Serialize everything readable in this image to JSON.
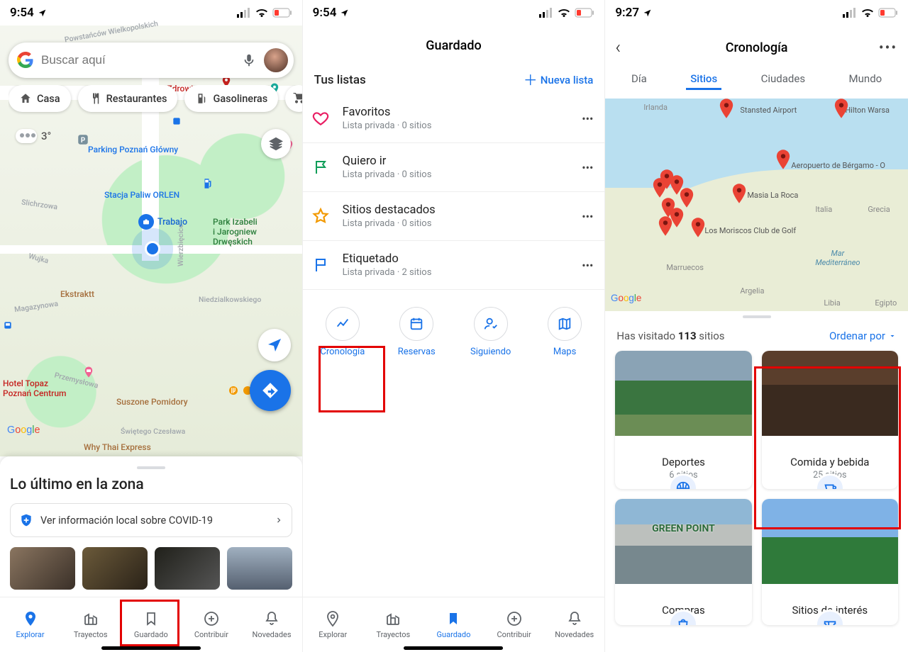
{
  "status": {
    "time1": "9:54",
    "time2": "9:54",
    "time3": "9:27"
  },
  "s1": {
    "search_placeholder": "Buscar aquí",
    "chips": {
      "home": "Casa",
      "restaurants": "Restaurantes",
      "gas": "Gasolineras"
    },
    "weather": "3°",
    "work_label": "Trabajo",
    "map_labels": {
      "pzu": "PZU Zdrowie",
      "parking": "Parking Poznań Główny",
      "orlen": "Stacja Paliw ORLEN",
      "park": "Park Izabeli\ni Jarogniew\nDrwęskich",
      "ekstraktt": "Ekstraktt",
      "topaz": "Hotel Topaz\nPoznań Centrum",
      "suszone": "Suszone Pomidory",
      "thai": "Why Thai Express",
      "slichrzowa": "Slichrzowa",
      "wierzbięcice": "Wierzbięcice",
      "niedz": "Niedzialkowskiego",
      "magazynowa": "Magazynowa",
      "przemyslowa": "Przemysłowa",
      "wujka": "Wujka",
      "swietego": "Świętego Czesława",
      "powstancow": "Powstańców Wielkopolskich"
    },
    "sheet_title": "Lo último en la zona",
    "covid_text": "Ver información local sobre COVID-19"
  },
  "nav": {
    "explore": "Explorar",
    "commute": "Trayectos",
    "saved": "Guardado",
    "contribute": "Contribuir",
    "updates": "Novedades"
  },
  "s2": {
    "title": "Guardado",
    "lists_title": "Tus listas",
    "new_list": "Nueva lista",
    "rows": [
      {
        "t": "Favoritos",
        "s": "Lista privada · 0 sitios"
      },
      {
        "t": "Quiero ir",
        "s": "Lista privada · 0 sitios"
      },
      {
        "t": "Sitios destacados",
        "s": "Lista privada · 0 sitios"
      },
      {
        "t": "Etiquetado",
        "s": "Lista privada · 2 sitios"
      }
    ],
    "quick": {
      "timeline": "Cronología",
      "reservations": "Reservas",
      "following": "Siguiendo",
      "maps": "Maps"
    }
  },
  "s3": {
    "title": "Cronología",
    "tabs": {
      "day": "Día",
      "places": "Sitios",
      "cities": "Ciudades",
      "world": "Mundo"
    },
    "visited_prefix": "Has visitado ",
    "visited_count": "113",
    "visited_suffix": " sitios",
    "sort": "Ordenar por",
    "map_labels": {
      "irlanda": "Irlanda",
      "stansted": "Stansted Airport",
      "hilton": "Hilton Warsa",
      "bergamo": "Aeropuerto de Bérgamo - O",
      "masia": "Masia La Roca",
      "moriscos": "Los Moriscos Club de Golf",
      "grecia": "Grecia",
      "italia": "Italia",
      "marruecos": "Marruecos",
      "argelia": "Argelia",
      "libia": "Libia",
      "egipto": "Egipto",
      "med": "Mar\nMediterráneo"
    },
    "cards": [
      {
        "n": "Deportes",
        "s": "6 sitios"
      },
      {
        "n": "Comida y bebida",
        "s": "25 sitios"
      },
      {
        "n": "Compras",
        "s": ""
      },
      {
        "n": "Sitios de interés",
        "s": ""
      }
    ]
  }
}
